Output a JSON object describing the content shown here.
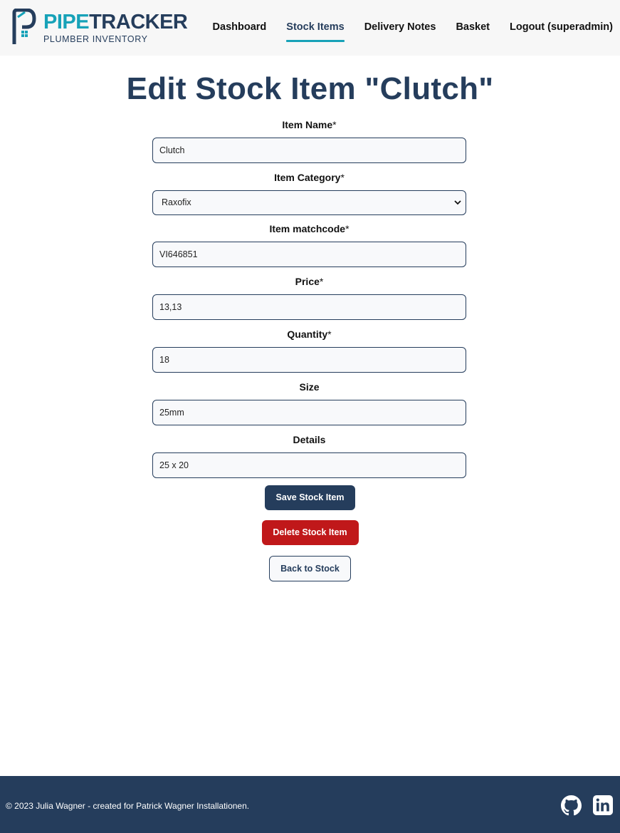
{
  "header": {
    "logo": {
      "title_part1": "PIPE",
      "title_part2": "TRACKER",
      "subtitle": "PLUMBER INVENTORY"
    },
    "nav": [
      {
        "label": "Dashboard",
        "active": false
      },
      {
        "label": "Stock Items",
        "active": true
      },
      {
        "label": "Delivery Notes",
        "active": false
      },
      {
        "label": "Basket",
        "active": false
      },
      {
        "label": "Logout (superadmin)",
        "active": false
      }
    ]
  },
  "page": {
    "title": "Edit Stock Item \"Clutch\""
  },
  "form": {
    "item_name": {
      "label": "Item Name",
      "required_mark": "*",
      "value": "Clutch"
    },
    "item_category": {
      "label": "Item Category",
      "required_mark": "*",
      "value": "Raxofix"
    },
    "item_matchcode": {
      "label": "Item matchcode",
      "required_mark": "*",
      "value": "VI646851"
    },
    "price": {
      "label": "Price",
      "required_mark": "*",
      "value": "13,13"
    },
    "quantity": {
      "label": "Quantity",
      "required_mark": "*",
      "value": "18"
    },
    "size": {
      "label": "Size",
      "value": "25mm"
    },
    "details": {
      "label": "Details",
      "value": "25 x 20"
    },
    "save_label": "Save Stock Item",
    "delete_label": "Delete Stock Item",
    "back_label": "Back to Stock"
  },
  "footer": {
    "copyright": "© 2023 Julia Wagner - created for Patrick Wagner Installationen."
  },
  "colors": {
    "brand_navy": "#253d5c",
    "brand_teal": "#17a2b8",
    "danger": "#c0181a"
  },
  "icons": [
    "pipetracker-logo-icon",
    "chevron-down-icon",
    "github-icon",
    "linkedin-icon"
  ]
}
